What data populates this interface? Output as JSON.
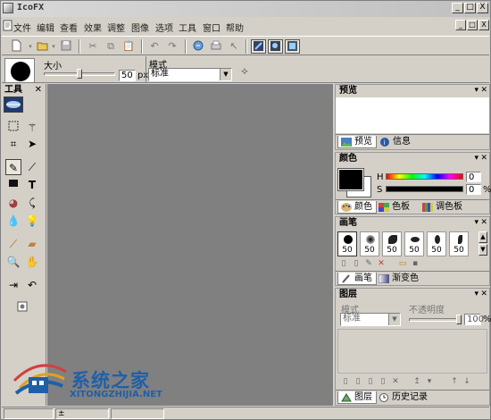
{
  "app": {
    "title": "IcoFX"
  },
  "menu": [
    "文件",
    "编辑",
    "查看",
    "效果",
    "调整",
    "图像",
    "选项",
    "工具",
    "窗口",
    "帮助"
  ],
  "window_controls": {
    "minimize": "_",
    "maximize": "□",
    "close": "X"
  },
  "toolbar": {
    "icons": [
      "new-icon",
      "open-icon",
      "save-icon",
      "cut-icon",
      "copy-icon",
      "paste-icon",
      "undo-icon",
      "redo-icon",
      "import-icon",
      "print-icon",
      "pointer-icon",
      "view-mode-1-icon",
      "view-mode-2-icon",
      "view-mode-3-icon"
    ]
  },
  "options": {
    "size_label": "大小",
    "size_value": "50",
    "size_unit": "px",
    "mode_label": "模式",
    "mode_value": "标准"
  },
  "tools_panel": {
    "title": "工具",
    "icons": [
      "brush-shape-icon",
      "rect-select-icon",
      "magic-wand-icon",
      "crop-icon",
      "move-icon",
      "pencil-icon",
      "brush-icon",
      "rectangle-icon",
      "text-icon",
      "fill-icon",
      "eyedropper-icon",
      "drop-icon",
      "bulb-icon",
      "line-icon",
      "eraser-icon",
      "zoom-icon",
      "hand-icon",
      "swap-icon",
      "undo-tool-icon",
      "screen-capture-icon"
    ]
  },
  "preview_panel": {
    "title": "预览",
    "tabs": [
      "预览",
      "信息"
    ]
  },
  "color_panel": {
    "title": "颜色",
    "h_label": "H",
    "h_value": "0",
    "s_label": "S",
    "s_value": "0",
    "percent": "%",
    "tabs": [
      "颜色",
      "色板",
      "调色板"
    ],
    "foreground": "#000000",
    "background": "#ffffff"
  },
  "brush_panel": {
    "title": "画笔",
    "sizes": [
      "50",
      "50",
      "50",
      "50",
      "50",
      "50"
    ],
    "tabs": [
      "画笔",
      "渐变色"
    ]
  },
  "layer_panel": {
    "title": "图层",
    "mode_label": "模式",
    "opacity_label": "不透明度",
    "mode_value": "标准",
    "opacity_value": "100",
    "percent": "%",
    "tabs": [
      "图层",
      "历史记录"
    ]
  },
  "watermark": {
    "text": "系统之家",
    "sub": "XITONGZHIJIA.NET"
  },
  "status": {
    "coords": "±"
  },
  "colors": {
    "canvas": "#808080",
    "chrome": "#d4d0c8",
    "accent": "#1f5fa8"
  }
}
